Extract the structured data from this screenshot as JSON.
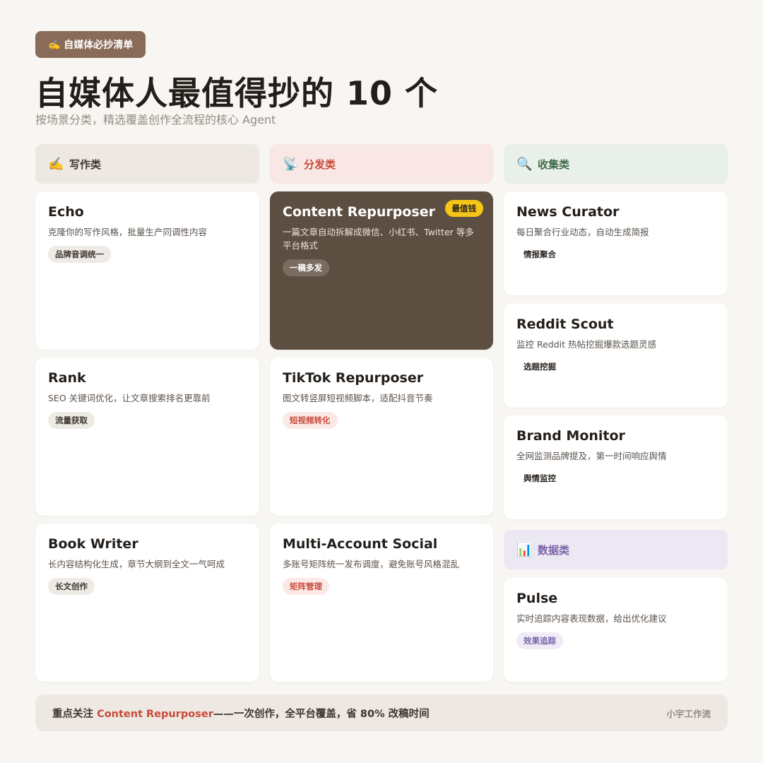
{
  "kicker": "✍️ 自媒体必抄清单",
  "title": "自媒体人最值得抄的 10 个",
  "subtitle": "按场景分类，精选覆盖创作全流程的核心 Agent",
  "categories": {
    "writing": {
      "icon": "✍️",
      "label": "写作类"
    },
    "distribution": {
      "icon": "📡",
      "label": "分发类"
    },
    "collection": {
      "icon": "🔍",
      "label": "收集类"
    },
    "data": {
      "icon": "📊",
      "label": "数据类"
    }
  },
  "cards": {
    "echo": {
      "title": "Echo",
      "desc": "克隆你的写作风格，批量生产同调性内容",
      "tag": "品牌音调统一"
    },
    "rank": {
      "title": "Rank",
      "desc": "SEO 关键词优化，让文章搜索排名更靠前",
      "tag": "流量获取"
    },
    "book_writer": {
      "title": "Book Writer",
      "desc": "长内容结构化生成，章节大纲到全文一气呵成",
      "tag": "长文创作"
    },
    "content_repurposer": {
      "title": "Content Repurposer",
      "badge": "最值钱",
      "desc": "一篇文章自动拆解成微信、小红书、Twitter 等多平台格式",
      "tag": "一稿多发"
    },
    "tiktok_repurposer": {
      "title": "TikTok Repurposer",
      "desc": "图文转竖屏短视频脚本，适配抖音节奏",
      "tag": "短视频转化"
    },
    "multi_account": {
      "title": "Multi-Account Social",
      "desc": "多账号矩阵统一发布调度，避免账号风格混乱",
      "tag": "矩阵管理"
    },
    "news_curator": {
      "title": "News Curator",
      "desc": "每日聚合行业动态，自动生成简报",
      "tag": "情报聚合"
    },
    "reddit_scout": {
      "title": "Reddit Scout",
      "desc": "监控 Reddit 热帖挖掘爆款选题灵感",
      "tag": "选题挖掘"
    },
    "brand_monitor": {
      "title": "Brand Monitor",
      "desc": "全网监测品牌提及，第一时间响应舆情",
      "tag": "舆情监控"
    },
    "pulse": {
      "title": "Pulse",
      "desc": "实时追踪内容表现数据，给出优化建议",
      "tag": "效果追踪"
    }
  },
  "footer": {
    "prefix": "重点关注 ",
    "highlight": "Content Repurposer",
    "suffix": "——一次创作，全平台覆盖，省 80% 改稿时间",
    "brand": "小宇工作流"
  }
}
